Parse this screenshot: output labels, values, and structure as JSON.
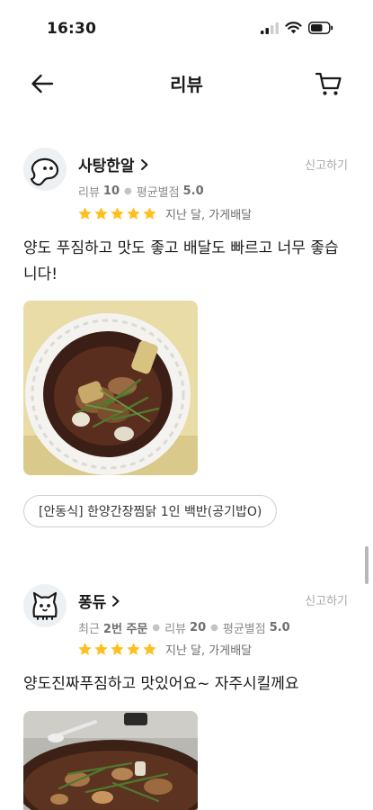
{
  "status_bar": {
    "time": "16:30"
  },
  "header": {
    "title": "리뷰"
  },
  "reviews": [
    {
      "user": "사탕한알",
      "report_label": "신고하기",
      "meta": [
        {
          "label": "리뷰",
          "value": "10"
        },
        {
          "label": "평균별점",
          "value": "5.0"
        }
      ],
      "stars": 5,
      "date_info": "지난 달, 가게배달",
      "text": "양도 푸짐하고 맛도 좋고 배달도 빠르고 너무 좋습니다!",
      "menu": "[안동식] 한양간장찜닭 1인 백반(공기밥O)"
    },
    {
      "user": "퐁듀",
      "report_label": "신고하기",
      "meta": [
        {
          "label": "최근",
          "value": "2번 주문"
        },
        {
          "label": "리뷰",
          "value": "20"
        },
        {
          "label": "평균별점",
          "value": "5.0"
        }
      ],
      "stars": 5,
      "date_info": "지난 달, 가게배달",
      "text": "양도진짜푸짐하고 맛있어요~ 자주시킬께요"
    }
  ],
  "colors": {
    "star": "#ffc01e",
    "report": "#a8a8a8",
    "meta": "#8c8c8c"
  }
}
